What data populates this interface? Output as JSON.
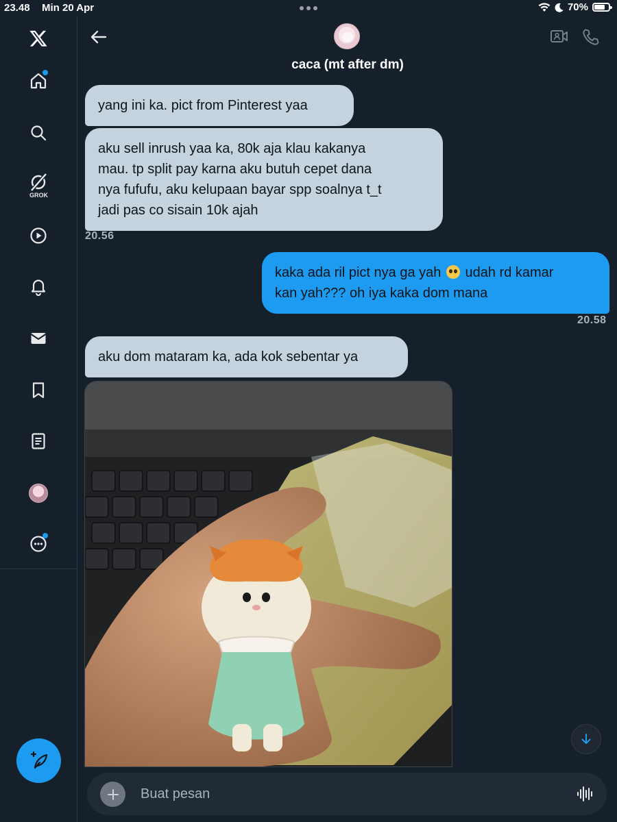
{
  "status_bar": {
    "time": "23.48",
    "date": "Min 20 Apr",
    "battery": "70%"
  },
  "sidebar": {
    "grok_label": "GROK",
    "items": [
      "logo-icon",
      "home-icon",
      "search-icon",
      "grok-icon",
      "video-icon",
      "notifications-icon",
      "messages-icon",
      "bookmark-icon",
      "lists-icon",
      "profile-avatar",
      "more-icon"
    ]
  },
  "header": {
    "name": "caca (mt after dm)"
  },
  "messages": [
    {
      "dir": "in",
      "text": "yang ini ka. pict from Pinterest yaa"
    },
    {
      "dir": "in",
      "lines": [
        "aku sell inrush yaa ka, 80k aja klau kakanya",
        "mau. tp split pay karna aku butuh cepet dana",
        "nya fufufu, aku kelupaan bayar spp soalnya t_t",
        "jadi pas co sisain 10k ajah"
      ],
      "time": "20.56"
    },
    {
      "dir": "out",
      "line1_before": "kaka ada ril pict nya ga yah",
      "line1_after": "udah rd kamar",
      "line2": "kan yah??? oh iya kaka dom mana",
      "time": "20.58"
    },
    {
      "dir": "in",
      "text": "aku dom mataram ka, ada kok sebentar ya"
    }
  ],
  "composer": {
    "placeholder": "Buat pesan"
  },
  "colors": {
    "background": "#15202b",
    "accent": "#1d9bf0",
    "incoming_bubble": "#c5d3de"
  }
}
